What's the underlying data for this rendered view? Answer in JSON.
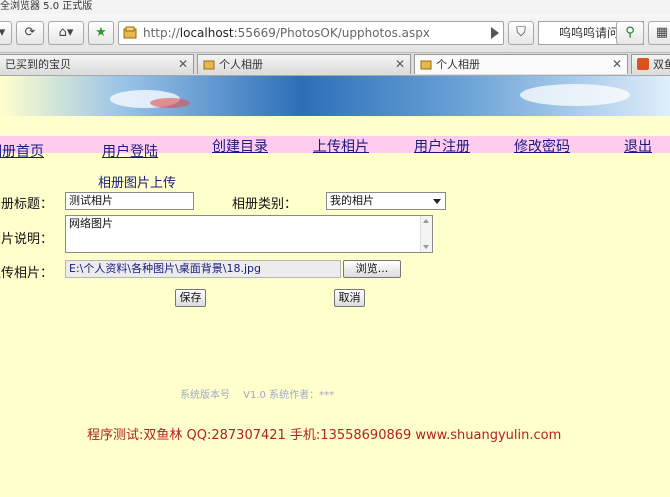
{
  "browser": {
    "title": "全浏览器 5.0 正式版",
    "url_prefix": "http://",
    "url_host": "localhost",
    "url_rest": ":55669/PhotosOK/upphotos.aspx",
    "search_text": "呜呜呜请问",
    "tabs": [
      {
        "label": "已买到的宝贝"
      },
      {
        "label": "个人相册"
      },
      {
        "label": "个人相册"
      },
      {
        "label": "双鱼"
      }
    ]
  },
  "nav": {
    "items": [
      "相册首页",
      "用户登陆",
      "创建目录",
      "上传相片",
      "用户注册",
      "修改密码",
      "退出"
    ]
  },
  "form": {
    "heading": "相册图片上传",
    "album_title_label": "相册标题：",
    "album_title_value": "测试相片",
    "album_category_label": "相册类别：",
    "album_category_value": "我的相片",
    "photo_desc_label": "相片说明：",
    "photo_desc_value": "网络图片",
    "upload_label": "上传相片：",
    "upload_value": "E:\\个人资料\\各种图片\\桌面背景\\18.jpg",
    "browse_label": "浏览...",
    "save_label": "保存",
    "cancel_label": "取消"
  },
  "footer": {
    "version": "系统版本号　 V1.0  系统作者：***",
    "credit": "程序测试:双鱼林 QQ:287307421 手机:13558690869 www.shuangyulin.com"
  },
  "colors": {
    "page_bg": "#ffffcc",
    "nav_bg": "#ffccee",
    "link": "#1a1a80",
    "credit": "#b22222"
  }
}
